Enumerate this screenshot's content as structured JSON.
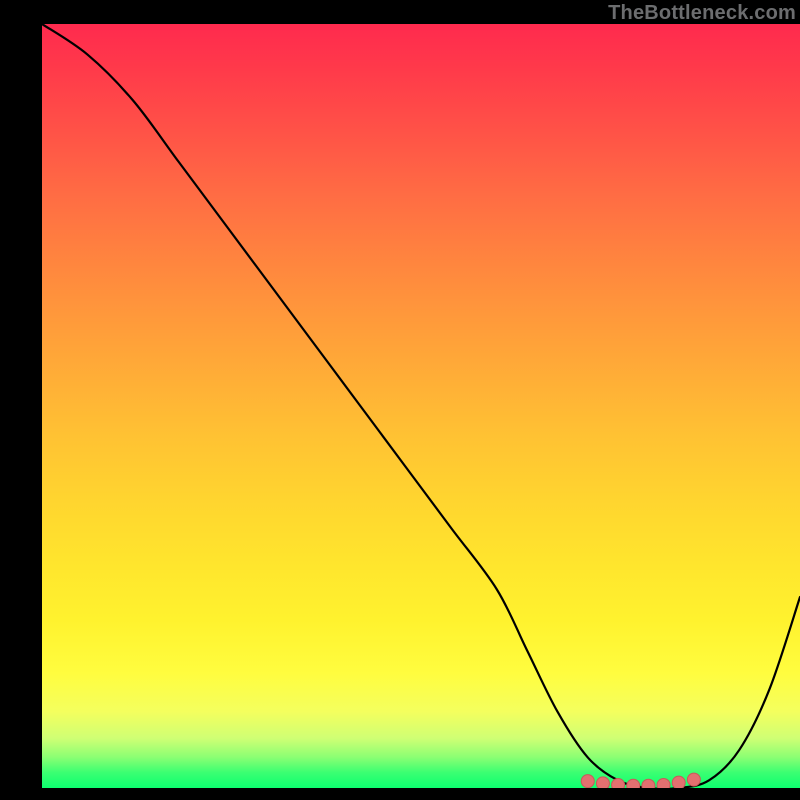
{
  "watermark": {
    "text": "TheBottleneck.com"
  },
  "chart_data": {
    "type": "line",
    "title": "",
    "xlabel": "",
    "ylabel": "",
    "xlim": [
      0,
      100
    ],
    "ylim": [
      0,
      100
    ],
    "grid": false,
    "series": [
      {
        "name": "curve",
        "x": [
          0,
          6,
          12,
          18,
          24,
          30,
          36,
          42,
          48,
          54,
          60,
          64,
          68,
          72,
          76,
          80,
          84,
          88,
          92,
          96,
          100
        ],
        "y": [
          100,
          96,
          90,
          82,
          74,
          66,
          58,
          50,
          42,
          34,
          26,
          18,
          10,
          4,
          1,
          0,
          0,
          1,
          5,
          13,
          25
        ]
      },
      {
        "name": "flat-region-markers",
        "x": [
          72,
          74,
          76,
          78,
          80,
          82,
          84,
          86
        ],
        "y": [
          0.9,
          0.6,
          0.4,
          0.3,
          0.3,
          0.4,
          0.7,
          1.1
        ]
      }
    ],
    "colors": {
      "curve": "#000000",
      "marker_fill": "#e27070",
      "marker_stroke": "#c85a5a"
    }
  }
}
